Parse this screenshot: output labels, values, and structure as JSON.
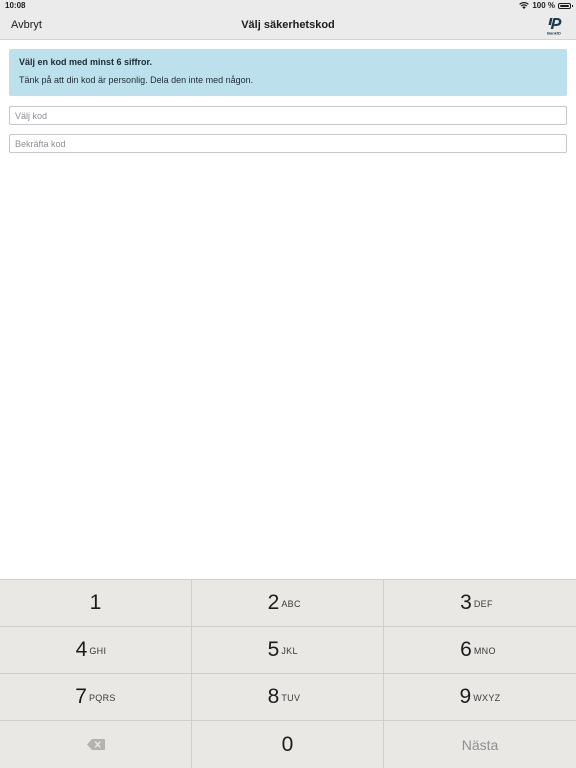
{
  "status_bar": {
    "time": "10:08",
    "battery_percent": "100 %",
    "icons": [
      "wifi-icon",
      "battery-icon"
    ]
  },
  "nav": {
    "cancel_label": "Avbryt",
    "title": "Välj säkerhetskod",
    "logo_text": "BankID"
  },
  "info": {
    "title": "Välj en kod med minst 6 siffror.",
    "body": "Tänk på att din kod är personlig. Dela den inte med någon."
  },
  "inputs": {
    "choose_placeholder": "Välj kod",
    "confirm_placeholder": "Bekräfta kod"
  },
  "keypad": {
    "keys": [
      {
        "num": "1",
        "letters": ""
      },
      {
        "num": "2",
        "letters": "ABC"
      },
      {
        "num": "3",
        "letters": "DEF"
      },
      {
        "num": "4",
        "letters": "GHI"
      },
      {
        "num": "5",
        "letters": "JKL"
      },
      {
        "num": "6",
        "letters": "MNO"
      },
      {
        "num": "7",
        "letters": "PQRS"
      },
      {
        "num": "8",
        "letters": "TUV"
      },
      {
        "num": "9",
        "letters": "WXYZ"
      }
    ],
    "zero": "0",
    "next_label": "Nästa"
  },
  "colors": {
    "info_bg": "#bde1ec",
    "bar_bg": "#ebebeb",
    "keypad_bg": "#e9e8e4",
    "brand": "#1d3b4f"
  }
}
